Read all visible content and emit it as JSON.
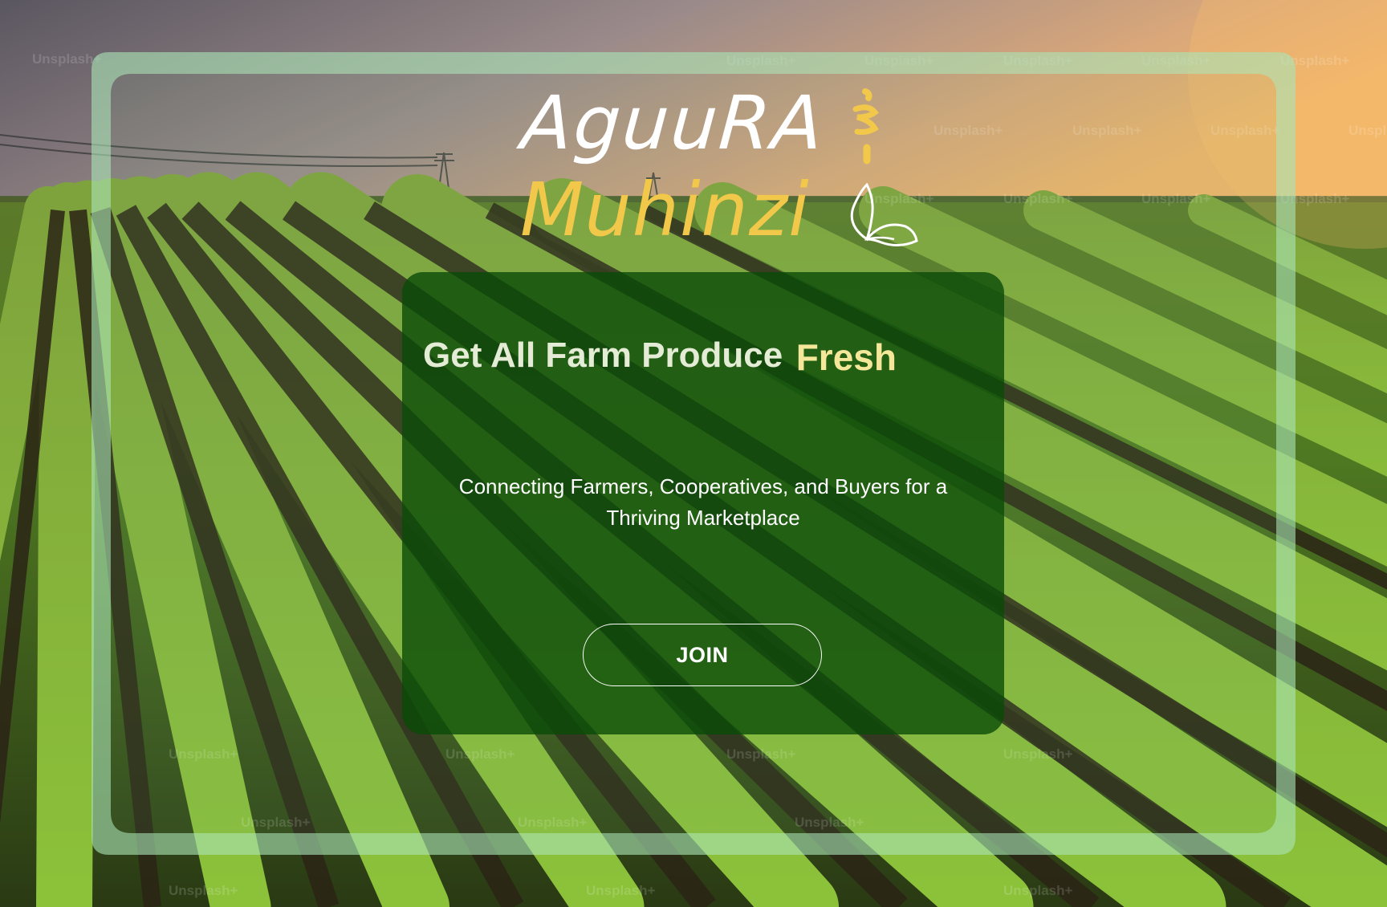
{
  "brand": {
    "name_line1": "AguuRA",
    "name_line2": "Muhinzi",
    "primary_color": "#ffffff",
    "accent_color": "#f2c84a",
    "logo_icons": [
      "accent-mark-icon",
      "leaf-icon"
    ]
  },
  "hero": {
    "title_main": "Get All Farm Produce",
    "title_accent": "Fresh",
    "subtitle": "Connecting Farmers, Cooperatives, and Buyers for a Thriving Marketplace",
    "join_label": "JOIN",
    "card_color": "#0a4b08",
    "title_color": "#e4ecd6",
    "title_accent_color": "#f4e79a"
  },
  "background": {
    "watermark_text": "Unsplash+",
    "frame_color": "#a5e1af"
  }
}
